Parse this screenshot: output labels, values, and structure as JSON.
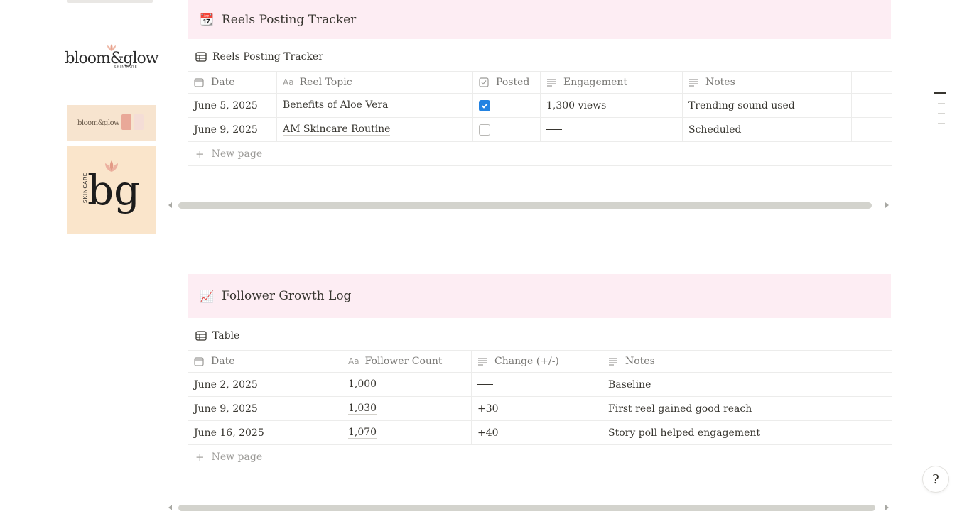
{
  "sidebar_images": {
    "logo_word": "bloom&glow",
    "logo_sub": "SKINCARE",
    "banner_word": "bloom&glow",
    "tile_letters": "bg",
    "tile_vertical": "SKINCARE"
  },
  "reels_section": {
    "emoji": "📆",
    "title": "Reels Posting Tracker",
    "db_title": "Reels Posting Tracker",
    "columns": [
      "Date",
      "Reel Topic",
      "Posted",
      "Engagement",
      "Notes"
    ],
    "rows": [
      {
        "date": "June 5, 2025",
        "topic": "Benefits of Aloe Vera",
        "posted": true,
        "engagement": "1,300 views",
        "notes": "Trending sound used"
      },
      {
        "date": "June 9, 2025",
        "topic": "AM Skincare Routine",
        "posted": false,
        "engagement": "",
        "notes": "Scheduled"
      }
    ],
    "new_page": "New page"
  },
  "follower_section": {
    "emoji": "📈",
    "title": "Follower Growth Log",
    "db_title": "Table",
    "columns": [
      "Date",
      "Follower Count",
      "Change (+/-)",
      "Notes"
    ],
    "rows": [
      {
        "date": "June 2, 2025",
        "count": "1,000",
        "change": "",
        "notes": "Baseline"
      },
      {
        "date": "June 9, 2025",
        "count": "1,030",
        "change": "+30",
        "notes": "First reel gained good reach"
      },
      {
        "date": "June 16, 2025",
        "count": "1,070",
        "change": "+40",
        "notes": "Story poll helped engagement"
      }
    ],
    "new_page": "New page"
  },
  "help_button": "?",
  "colors": {
    "header_bg": "#fdedf3",
    "checkbox_blue": "#2383e2",
    "tile_bg": "#fae5cb"
  }
}
